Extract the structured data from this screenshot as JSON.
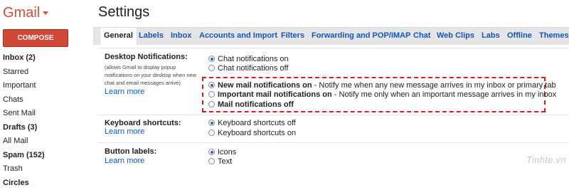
{
  "app": {
    "brand": "Gmail",
    "page_title": "Settings"
  },
  "sidebar": {
    "compose_label": "COMPOSE",
    "items": [
      {
        "label": "Inbox (2)",
        "bold": true
      },
      {
        "label": "Starred",
        "bold": false
      },
      {
        "label": "Important",
        "bold": false
      },
      {
        "label": "Chats",
        "bold": false
      },
      {
        "label": "Sent Mail",
        "bold": false
      },
      {
        "label": "Drafts (3)",
        "bold": true
      },
      {
        "label": "All Mail",
        "bold": false
      },
      {
        "label": "Spam (152)",
        "bold": true
      },
      {
        "label": "Trash",
        "bold": false
      },
      {
        "label": "Circles",
        "bold": true
      }
    ]
  },
  "tabs": [
    "General",
    "Labels",
    "Inbox",
    "Accounts and Import",
    "Filters",
    "Forwarding and POP/IMAP",
    "Chat",
    "Web Clips",
    "Labs",
    "Offline",
    "Themes"
  ],
  "active_tab": "General",
  "settings": {
    "desktop": {
      "label": "Desktop Notifications:",
      "note": "(allows Gmail to display popup notifications on your desktop when new chat and email messages arrive)",
      "learn_more": "Learn more",
      "chat_on": "Chat notifications on",
      "chat_off": "Chat notifications off",
      "new_mail_bold": "New mail notifications on",
      "new_mail_desc": " - Notify me when any new message arrives in my inbox or primary tab",
      "important_bold": "Important mail notifications on",
      "important_desc": " - Notify me only when an important message arrives in my inbox",
      "mail_off": "Mail notifications off"
    },
    "keyboard": {
      "label": "Keyboard shortcuts:",
      "learn_more": "Learn more",
      "off": "Keyboard shortcuts off",
      "on": "Keyboard shortcuts on"
    },
    "buttons": {
      "label": "Button labels:",
      "learn_more": "Learn more",
      "icons": "Icons",
      "text": "Text"
    }
  },
  "watermark": "Tinhte.vn",
  "colors": {
    "brand": "#dd4b39",
    "compose": "#d14836",
    "link": "#1155cc",
    "highlight": "#d7201a"
  }
}
